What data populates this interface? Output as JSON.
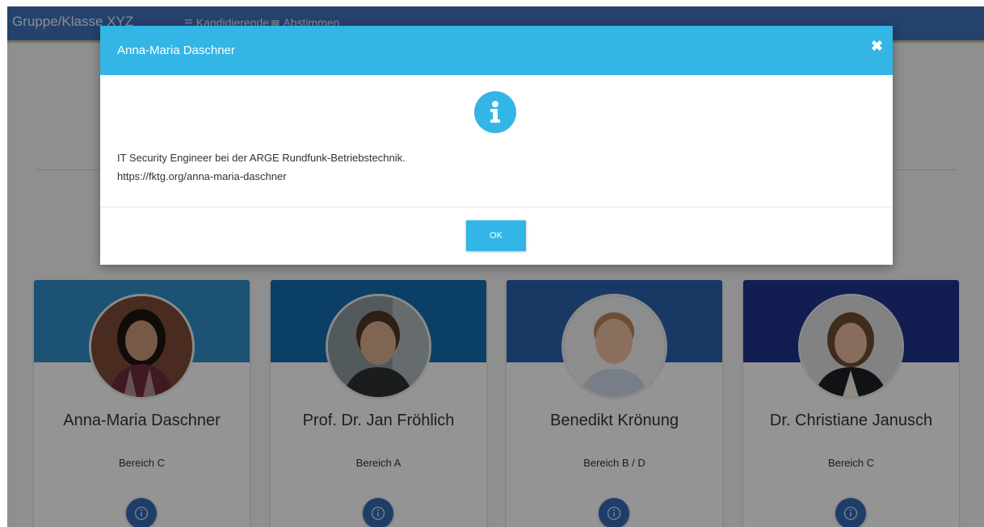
{
  "navbar": {
    "brand": "Gruppe/Klasse XYZ",
    "links": [
      {
        "label": "Kandidierende",
        "icon": "list-icon"
      },
      {
        "label": "Abstimmen",
        "icon": "ballot-icon"
      }
    ]
  },
  "cards": [
    {
      "name": "Anna-Maria Daschner",
      "area": "Bereich C",
      "header_color": "#2f8bc2"
    },
    {
      "name": "Prof. Dr. Jan Fröhlich",
      "area": "Bereich A",
      "header_color": "#126ba9"
    },
    {
      "name": "Benedikt Krönung",
      "area": "Bereich B / D",
      "header_color": "#2b60a9"
    },
    {
      "name": "Dr. Christiane Janusch",
      "area": "Bereich C",
      "header_color": "#1f3389"
    }
  ],
  "modal": {
    "title": "Anna-Maria Daschner",
    "text_line1": "IT Security Engineer bei der ARGE Rundfunk-Betriebstechnik.",
    "text_line2": "https://fktg.org/anna-maria-daschner",
    "ok_label": "OK"
  },
  "colors": {
    "accent": "#33b5e6",
    "navbar": "#3f6fb6",
    "info_button": "#3566b0"
  }
}
